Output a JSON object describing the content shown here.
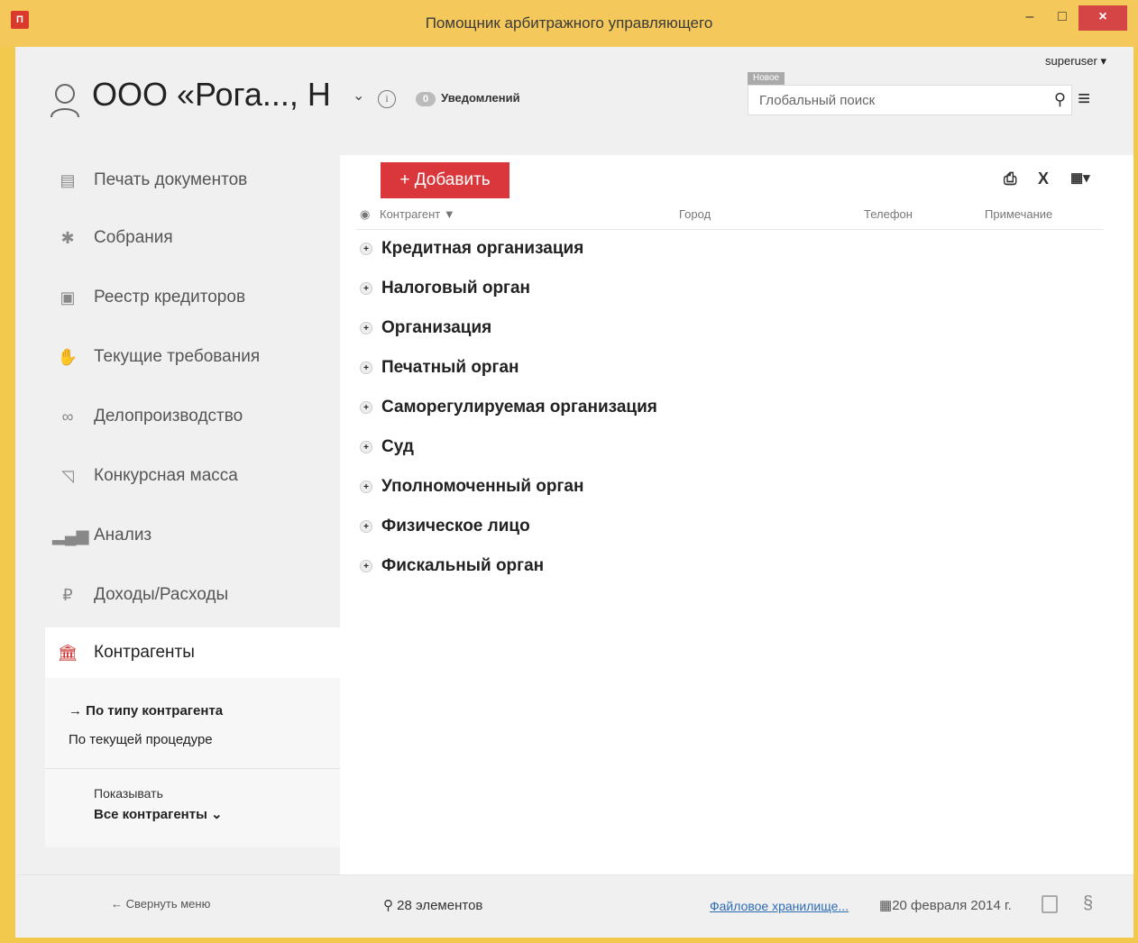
{
  "window": {
    "title": "Помощник арбитражного управляющего",
    "app_icon": "П",
    "minimize": "–",
    "maximize": "□",
    "close": "×"
  },
  "header": {
    "user": "superuser ▾",
    "org_name": "ООО «Рога..., Н",
    "org_chevron": "⌄",
    "info_icon": "i",
    "notifications_count": "0",
    "notifications_label": "Уведомлений",
    "new_badge": "Новое",
    "search_placeholder": "Глобальный поиск"
  },
  "sidebar": {
    "items": [
      {
        "label": "Печать документов",
        "icon": "document-icon"
      },
      {
        "label": "Собрания",
        "icon": "handshake-icon"
      },
      {
        "label": "Реестр кредиторов",
        "icon": "id-card-icon"
      },
      {
        "label": "Текущие требования",
        "icon": "hand-icon"
      },
      {
        "label": "Делопроизводство",
        "icon": "paperclip-icon"
      },
      {
        "label": "Конкурсная масса",
        "icon": "basket-icon"
      },
      {
        "label": "Анализ",
        "icon": "bar-chart-icon"
      },
      {
        "label": "Доходы/Расходы",
        "icon": "ruble-icon"
      },
      {
        "label": "Контрагенты",
        "icon": "bank-icon"
      }
    ],
    "submenu": {
      "by_type": "→ По типу контрагента",
      "by_procedure": "По текущей процедуре",
      "show_label": "Показывать",
      "show_value": "Все контрагенты ⌄"
    }
  },
  "content": {
    "add_button": "+ Добавить",
    "columns": [
      "Контрагент ▼",
      "Город",
      "Телефон",
      "Примечание"
    ],
    "groups": [
      "Кредитная организация",
      "Налоговый орган",
      "Организация",
      "Печатный орган",
      "Саморегулируемая организация",
      "Суд",
      "Уполномоченный орган",
      "Физическое лицо",
      "Фискальный орган"
    ]
  },
  "footer": {
    "collapse": "← Свернуть меню",
    "count": "28 элементов",
    "storage_link": "Файловое хранилище...",
    "date": "20 февраля 2014 г."
  }
}
